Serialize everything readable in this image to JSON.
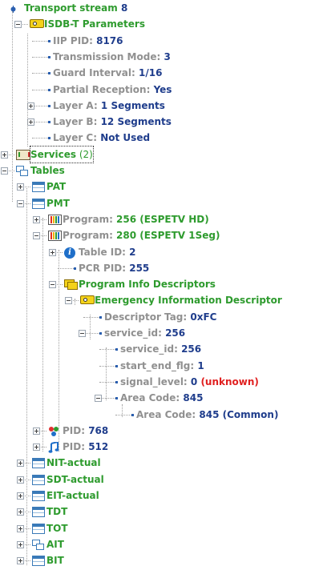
{
  "tree": {
    "rows": [
      {
        "parts": [
          [
            "Transport stream",
            "g"
          ],
          [
            "  8",
            "b"
          ]
        ]
      },
      {
        "parts": [
          [
            "ISDB-T Parameters",
            "g"
          ]
        ]
      },
      {
        "parts": [
          [
            "IIP PID:",
            "gr"
          ],
          [
            "  8176",
            "b"
          ]
        ]
      },
      {
        "parts": [
          [
            "Transmission Mode:",
            "gr"
          ],
          [
            "  3",
            "b"
          ]
        ]
      },
      {
        "parts": [
          [
            "Guard Interval:",
            "gr"
          ],
          [
            "  1/16",
            "b"
          ]
        ]
      },
      {
        "parts": [
          [
            "Partial Reception:",
            "gr"
          ],
          [
            "  Yes",
            "b"
          ]
        ]
      },
      {
        "parts": [
          [
            "Layer A:",
            "gr"
          ],
          [
            "  1 Segments",
            "b"
          ]
        ]
      },
      {
        "parts": [
          [
            "Layer B:",
            "gr"
          ],
          [
            "  12 Segments",
            "b"
          ]
        ]
      },
      {
        "parts": [
          [
            "Layer C:",
            "gr"
          ],
          [
            "  Not Used",
            "b"
          ]
        ]
      },
      {
        "parts": [
          [
            "Services",
            "g"
          ],
          [
            " (2)",
            "pl"
          ]
        ]
      },
      {
        "parts": [
          [
            "Tables",
            "g"
          ]
        ]
      },
      {
        "parts": [
          [
            "PAT",
            "g"
          ]
        ]
      },
      {
        "parts": [
          [
            "PMT",
            "g"
          ]
        ]
      },
      {
        "parts": [
          [
            "Program:",
            "gr"
          ],
          [
            "  256  (ESPETV HD)",
            "g"
          ]
        ]
      },
      {
        "parts": [
          [
            "Program:",
            "gr"
          ],
          [
            "  280  (ESPETV 1Seg)",
            "g"
          ]
        ]
      },
      {
        "parts": [
          [
            "Table ID:",
            "gr"
          ],
          [
            "  2",
            "b"
          ]
        ]
      },
      {
        "parts": [
          [
            "PCR PID:",
            "gr"
          ],
          [
            "  255",
            "b"
          ]
        ]
      },
      {
        "parts": [
          [
            "Program Info Descriptors",
            "g"
          ]
        ]
      },
      {
        "parts": [
          [
            "Emergency Information Descriptor",
            "g"
          ]
        ]
      },
      {
        "parts": [
          [
            "Descriptor Tag:",
            "gr"
          ],
          [
            "  0xFC",
            "b"
          ]
        ]
      },
      {
        "parts": [
          [
            "service_id:",
            "gr"
          ],
          [
            "  256",
            "b"
          ]
        ]
      },
      {
        "parts": [
          [
            "service_id:",
            "gr"
          ],
          [
            "  256",
            "b"
          ]
        ]
      },
      {
        "parts": [
          [
            "start_end_flg:",
            "gr"
          ],
          [
            "  1",
            "b"
          ]
        ]
      },
      {
        "parts": [
          [
            "signal_level:",
            "gr"
          ],
          [
            "  0",
            "b"
          ],
          [
            "  (unknown)",
            "r"
          ]
        ]
      },
      {
        "parts": [
          [
            "Area Code:",
            "gr"
          ],
          [
            "  845",
            "b"
          ]
        ]
      },
      {
        "parts": [
          [
            "Area Code:",
            "gr"
          ],
          [
            "  845  (Common)",
            "b"
          ]
        ]
      },
      {
        "parts": [
          [
            "PID:",
            "gr"
          ],
          [
            "  768",
            "b"
          ]
        ]
      },
      {
        "parts": [
          [
            "PID:",
            "gr"
          ],
          [
            "  512",
            "b"
          ]
        ]
      },
      {
        "parts": [
          [
            "NIT-actual",
            "g"
          ]
        ]
      },
      {
        "parts": [
          [
            "SDT-actual",
            "g"
          ]
        ]
      },
      {
        "parts": [
          [
            "EIT-actual",
            "g"
          ]
        ]
      },
      {
        "parts": [
          [
            "TDT",
            "g"
          ]
        ]
      },
      {
        "parts": [
          [
            "TOT",
            "g"
          ]
        ]
      },
      {
        "parts": [
          [
            "AIT",
            "g"
          ]
        ]
      },
      {
        "parts": [
          [
            "BIT",
            "g"
          ]
        ]
      }
    ]
  },
  "icons": {
    "root": "transport-stream-icon",
    "param": "tag-icon",
    "services": "services-icon",
    "tables": "tables-icon",
    "table": "table-icon",
    "program": "program-icon",
    "info": "info-icon",
    "descs": "descriptors-icon",
    "pid_video": "video-pid-icon",
    "pid_audio": "audio-pid-icon"
  },
  "colors": {
    "label_green": "#2e9b2e",
    "label_gray": "#909090",
    "value_blue": "#1f3d8c",
    "warning_red": "#e02020"
  }
}
